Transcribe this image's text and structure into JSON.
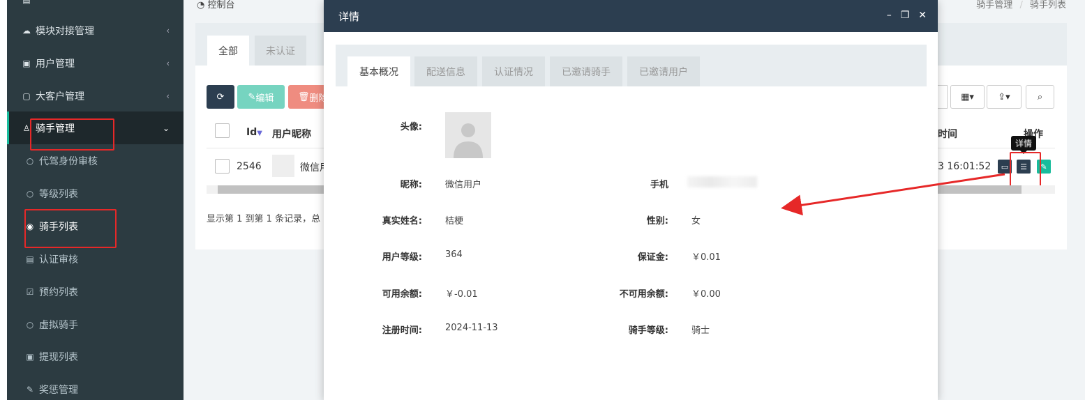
{
  "breadcrumb": {
    "home_label": "控制台",
    "right_parent": "骑手管理",
    "right_sep": "/",
    "right_current": "骑手列表"
  },
  "sidebar": {
    "items": [
      {
        "label": "模块对接管理"
      },
      {
        "label": "用户管理"
      },
      {
        "label": "大客户管理"
      },
      {
        "label": "骑手管理"
      }
    ],
    "subitems": [
      {
        "label": "代驾身份审核"
      },
      {
        "label": "等级列表"
      },
      {
        "label": "骑手列表"
      },
      {
        "label": "认证审核"
      },
      {
        "label": "预约列表"
      },
      {
        "label": "虚拟骑手"
      },
      {
        "label": "提现列表"
      },
      {
        "label": "奖惩管理"
      }
    ]
  },
  "main": {
    "tabs": [
      {
        "label": "全部"
      },
      {
        "label": "未认证"
      }
    ],
    "toolbar": {
      "edit_label": "编辑",
      "delete_label": "删除"
    },
    "columns": {
      "id": "Id",
      "nickname": "用户昵称",
      "time": "时间",
      "ops": "操作"
    },
    "row": {
      "id": "2546",
      "nickname": "微信用",
      "time": "3 16:01:52"
    },
    "footer": "显示第 1 到第 1 条记录，总",
    "tooltip": "详情"
  },
  "modal": {
    "title": "详情",
    "tabs": [
      {
        "label": "基本概况"
      },
      {
        "label": "配送信息"
      },
      {
        "label": "认证情况"
      },
      {
        "label": "已邀请骑手"
      },
      {
        "label": "已邀请用户"
      }
    ],
    "fields": {
      "avatar_label": "头像:",
      "nickname_label": "昵称:",
      "nickname": "微信用户",
      "phone_label": "手机",
      "realname_label": "真实姓名:",
      "realname": "桔梗",
      "gender_label": "性别:",
      "gender": "女",
      "level_label": "用户等级:",
      "level": "364",
      "deposit_label": "保证金:",
      "deposit": "￥0.01",
      "available_label": "可用余额:",
      "available": "￥-0.01",
      "unavailable_label": "不可用余额:",
      "unavailable": "￥0.00",
      "regtime_label": "注册时间:",
      "regtime": "2024-11-13",
      "riderlevel_label": "骑手等级:",
      "riderlevel": "骑士"
    }
  },
  "colors": {
    "sidebar": "#2c3b41",
    "modal_header": "#2c3e50",
    "accent": "#18bc9c",
    "annotation": "#e62828"
  }
}
